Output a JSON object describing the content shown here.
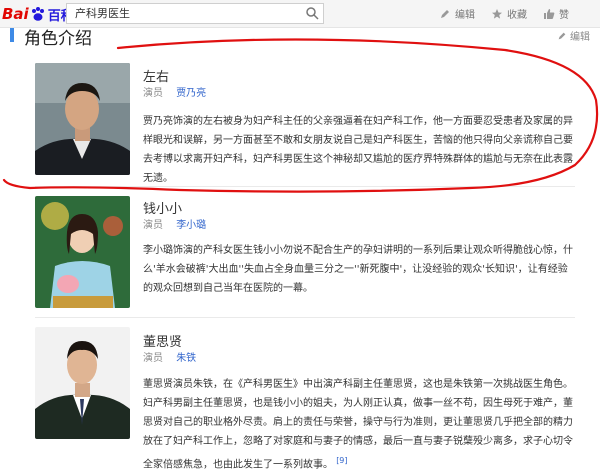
{
  "header": {
    "logo_bai": "Bai",
    "logo_du": "百科",
    "search_value": "产科男医生",
    "edit_label": "编辑",
    "favorite_label": "收藏",
    "like_label": "赞"
  },
  "section": {
    "title": "角色介绍",
    "edit_label": "编辑"
  },
  "roles": [
    {
      "name": "左右",
      "actor_label": "演员",
      "actor": "贾乃亮",
      "description": "贾乃亮饰演的左右被身为妇产科主任的父亲强逼着在妇产科工作，他一方面要忍受患者及家属的异样眼光和误解，另一方面甚至不敢和女朋友说自己是妇产科医生，苦恼的他只得向父亲谎称自己要去考博以求离开妇产科，妇产科男医生这个神秘却又尴尬的医疗界特殊群体的尴尬与无奈在此表露无遗。"
    },
    {
      "name": "钱小小",
      "actor_label": "演员",
      "actor": "李小璐",
      "description": "李小璐饰演的产科女医生钱小小勿说不配合生产的孕妇讲明的一系列后果让观众听得脆戗心惊，什么'羊水会破裤'大出血''失血占全身血量三分之一''新死腹中'，让没经验的观众'长知识'，让有经验的观众回想到自己当年在医院的一幕。"
    },
    {
      "name": "董思贤",
      "actor_label": "演员",
      "actor": "朱铁",
      "description": "董思贤演员朱铁，在《产科男医生》中出演产科副主任董思贤，这也是朱铁第一次挑战医生角色。妇产科男副主任董思贤，也是钱小小的姐夫，为人刚正认真，做事一丝不苟，因生母死于难产，董思贤对自己的职业格外尽责。肩上的责任与荣誉，操守与行为准则，更让董思贤几乎把全部的精力放在了妇产科工作上，忽略了对家庭和与妻子的情感，最后一直与妻子锐蘖殁少离多，求子心切令全家倍感焦急，也由此发生了一系列故事。",
      "ref": "[9]"
    }
  ],
  "colors": {
    "accent": "#3e8ae6",
    "link": "#3366cc",
    "annotation": "#e01010"
  }
}
